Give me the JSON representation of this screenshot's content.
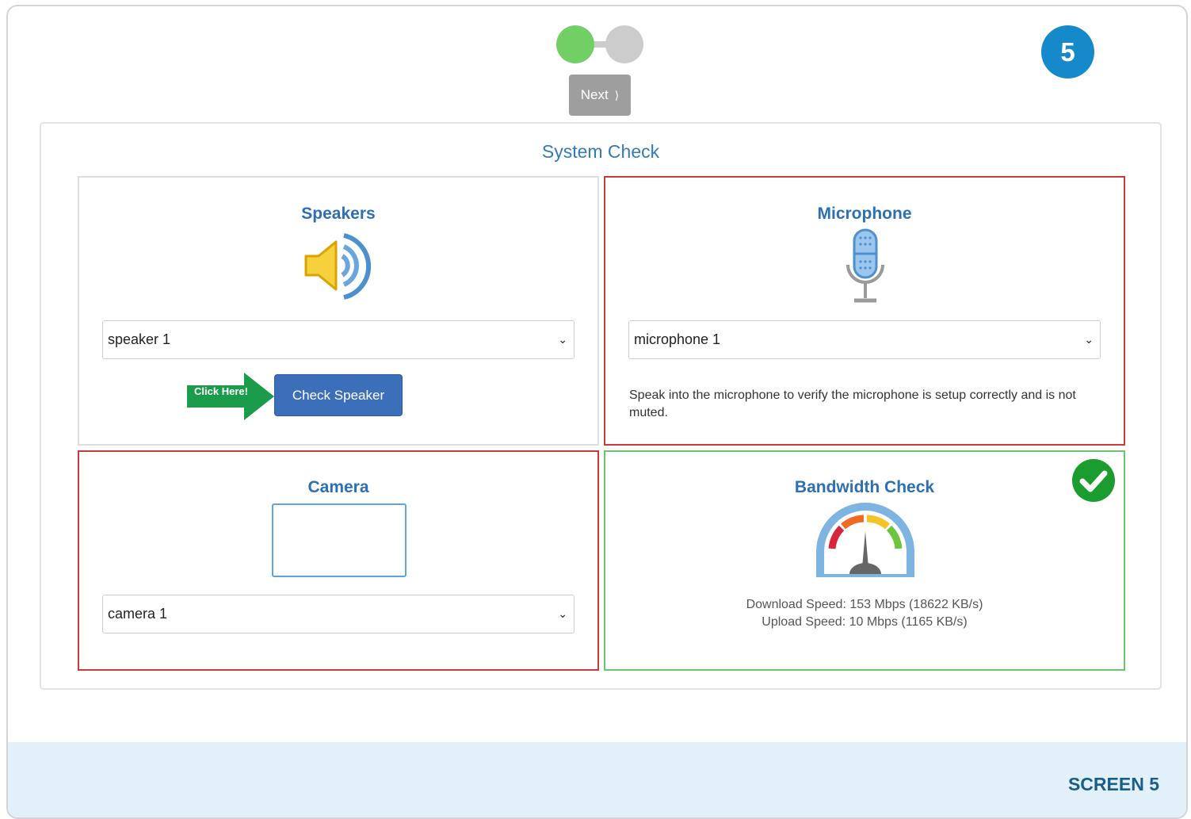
{
  "header": {
    "step_badge": "5",
    "next_label": "Next",
    "next_chevron": "⟩"
  },
  "panel": {
    "title": "System Check"
  },
  "speakers": {
    "title": "Speakers",
    "select_value": "speaker 1",
    "callout_label": "Click Here!",
    "check_button": "Check Speaker",
    "icon": "speaker-icon"
  },
  "microphone": {
    "title": "Microphone",
    "select_value": "microphone 1",
    "help_text": "Speak into the microphone to verify the microphone is setup correctly and is not muted.",
    "icon": "microphone-icon"
  },
  "camera": {
    "title": "Camera",
    "select_value": "camera 1"
  },
  "bandwidth": {
    "title": "Bandwidth Check",
    "download": "Download Speed: 153 Mbps (18622 KB/s)",
    "upload": "Upload Speed: 10 Mbps (1165 KB/s)",
    "status_icon": "checkmark-circle-icon"
  },
  "footer": {
    "label": "SCREEN 5"
  },
  "colors": {
    "accent_blue": "#337ab7",
    "step_done": "#72cf66",
    "step_pending": "#cccccc",
    "error_border": "#cc3b3b",
    "ok_border": "#6dc46a",
    "badge": "#1589c9"
  }
}
